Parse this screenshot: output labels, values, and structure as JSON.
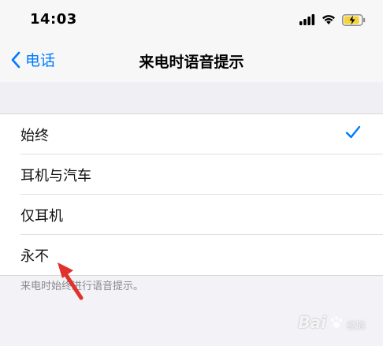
{
  "status_bar": {
    "time": "14:03",
    "icons": [
      "signal-icon",
      "wifi-icon",
      "battery-charging-icon"
    ]
  },
  "nav": {
    "back_label": "电话",
    "title": "来电时语音提示"
  },
  "options": [
    {
      "label": "始终",
      "selected": true
    },
    {
      "label": "耳机与汽车",
      "selected": false
    },
    {
      "label": "仅耳机",
      "selected": false
    },
    {
      "label": "永不",
      "selected": false
    }
  ],
  "footer": {
    "note": "来电时始终进行语音提示。"
  },
  "watermark": {
    "brand": "Bai",
    "suffix": "经验"
  },
  "colors": {
    "accent": "#007aff",
    "annotation": "#e0312b",
    "battery": "#f5d33b"
  }
}
